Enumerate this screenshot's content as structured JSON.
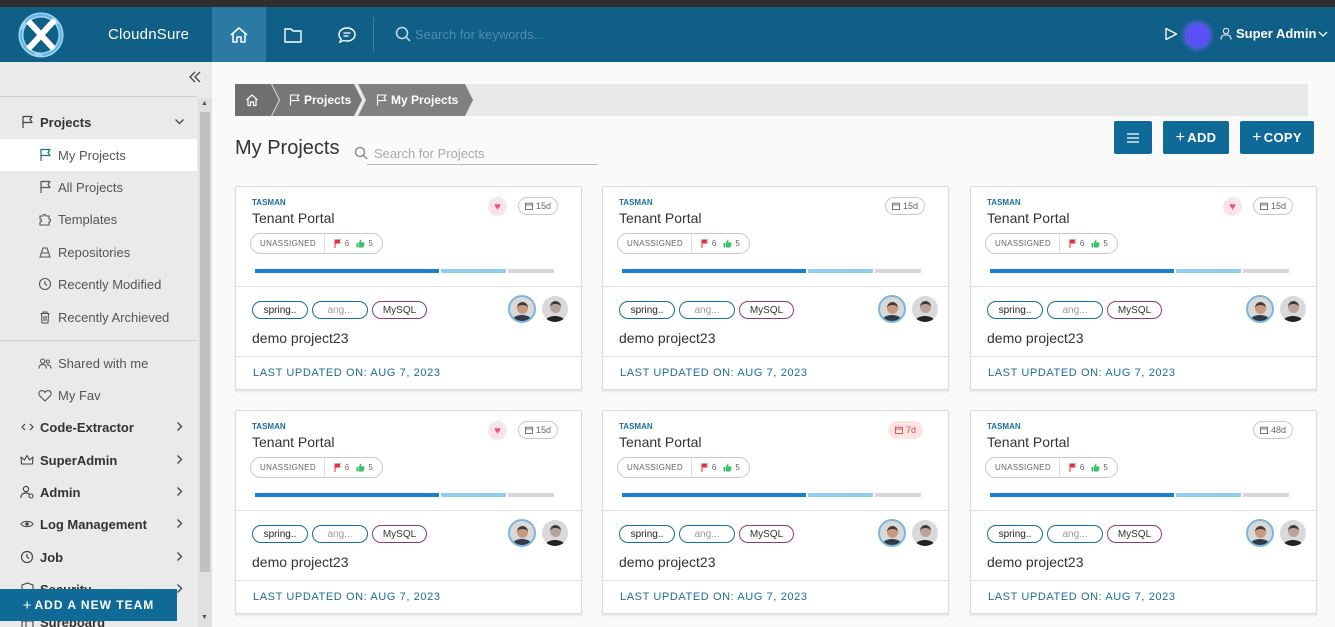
{
  "app": {
    "brand": "CloudnSure",
    "search_placeholder": "Search for keywords...",
    "user_name": "Super Admin",
    "accent": "#0f5f86",
    "add_team_label": "ADD A NEW TEAM"
  },
  "sidebar": {
    "projects": "Projects",
    "sub": {
      "my_projects": "My Projects",
      "all_projects": "All Projects",
      "templates": "Templates",
      "repositories": "Repositories",
      "recently_modified": "Recently Modified",
      "recently_archived": "Recently Archieved",
      "shared": "Shared with me",
      "fav": "My Fav"
    },
    "items": {
      "code_extractor": "Code-Extractor",
      "superadmin": "SuperAdmin",
      "admin": "Admin",
      "log_management": "Log Management",
      "job": "Job",
      "security": "Security",
      "sureboard": "Sureboard"
    }
  },
  "breadcrumb": {
    "level1": "Projects",
    "level2": "My Projects"
  },
  "main": {
    "title": "My Projects",
    "search_placeholder": "Search for Projects",
    "add_label": "ADD",
    "copy_label": "COPY"
  },
  "cards": [
    {
      "client": "TASMAN",
      "title": "Tenant Portal",
      "favorite": true,
      "days": "15d",
      "status": "UNASSIGNED",
      "flags": "6",
      "likes": "5",
      "tags": [
        "spring..",
        "ang...",
        "MySQL"
      ],
      "desc": "demo project23",
      "updated": "LAST UPDATED ON: AUG 7, 2023"
    },
    {
      "client": "TASMAN",
      "title": "Tenant Portal",
      "favorite": false,
      "days": "15d",
      "status": "UNASSIGNED",
      "flags": "6",
      "likes": "5",
      "tags": [
        "spring..",
        "ang...",
        "MySQL"
      ],
      "desc": "demo project23",
      "updated": "LAST UPDATED ON: AUG 7, 2023"
    },
    {
      "client": "TASMAN",
      "title": "Tenant Portal",
      "favorite": true,
      "days": "15d",
      "status": "UNASSIGNED",
      "flags": "6",
      "likes": "5",
      "tags": [
        "spring..",
        "ang...",
        "MySQL"
      ],
      "desc": "demo project23",
      "updated": "LAST UPDATED ON: AUG 7, 2023"
    },
    {
      "client": "TASMAN",
      "title": "Tenant Portal",
      "favorite": true,
      "days": "15d",
      "status": "UNASSIGNED",
      "flags": "6",
      "likes": "5",
      "tags": [
        "spring..",
        "ang...",
        "MySQL"
      ],
      "desc": "demo project23",
      "updated": "LAST UPDATED ON: AUG 7, 2023"
    },
    {
      "client": "TASMAN",
      "title": "Tenant Portal",
      "favorite": false,
      "days": "7d",
      "days_alert": true,
      "status": "UNASSIGNED",
      "flags": "6",
      "likes": "5",
      "tags": [
        "spring..",
        "ang...",
        "MySQL"
      ],
      "desc": "demo project23",
      "updated": "LAST UPDATED ON: AUG 7, 2023"
    },
    {
      "client": "TASMAN",
      "title": "Tenant Portal",
      "favorite": false,
      "days": "48d",
      "status": "UNASSIGNED",
      "flags": "6",
      "likes": "5",
      "tags": [
        "spring..",
        "ang...",
        "MySQL"
      ],
      "desc": "demo project23",
      "updated": "LAST UPDATED ON: AUG 7, 2023"
    }
  ]
}
